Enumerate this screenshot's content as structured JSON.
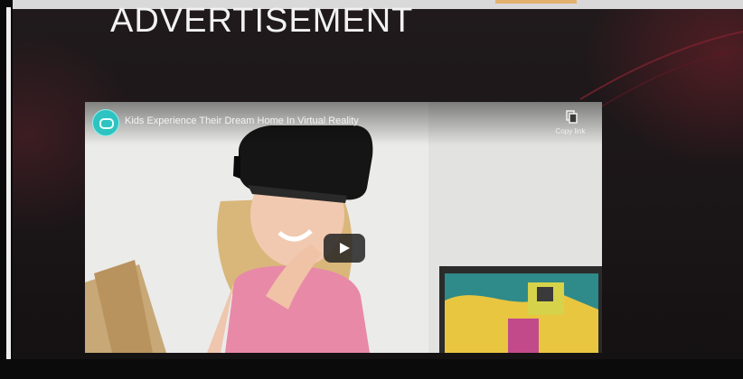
{
  "slide": {
    "title": "ADVERTISEMENT"
  },
  "video": {
    "title": "Kids Experience Their Dream Home In Virtual Reality",
    "copy_link_label": "Copy link",
    "channel_logo": "circle-logo-icon",
    "play_icon": "play-icon",
    "copy_icon": "copy-icon"
  },
  "colors": {
    "background": "#1b1618",
    "accent_glow": "#8c232d",
    "logo_teal": "#2dc3c0",
    "dress_pink": "#e889a8"
  }
}
